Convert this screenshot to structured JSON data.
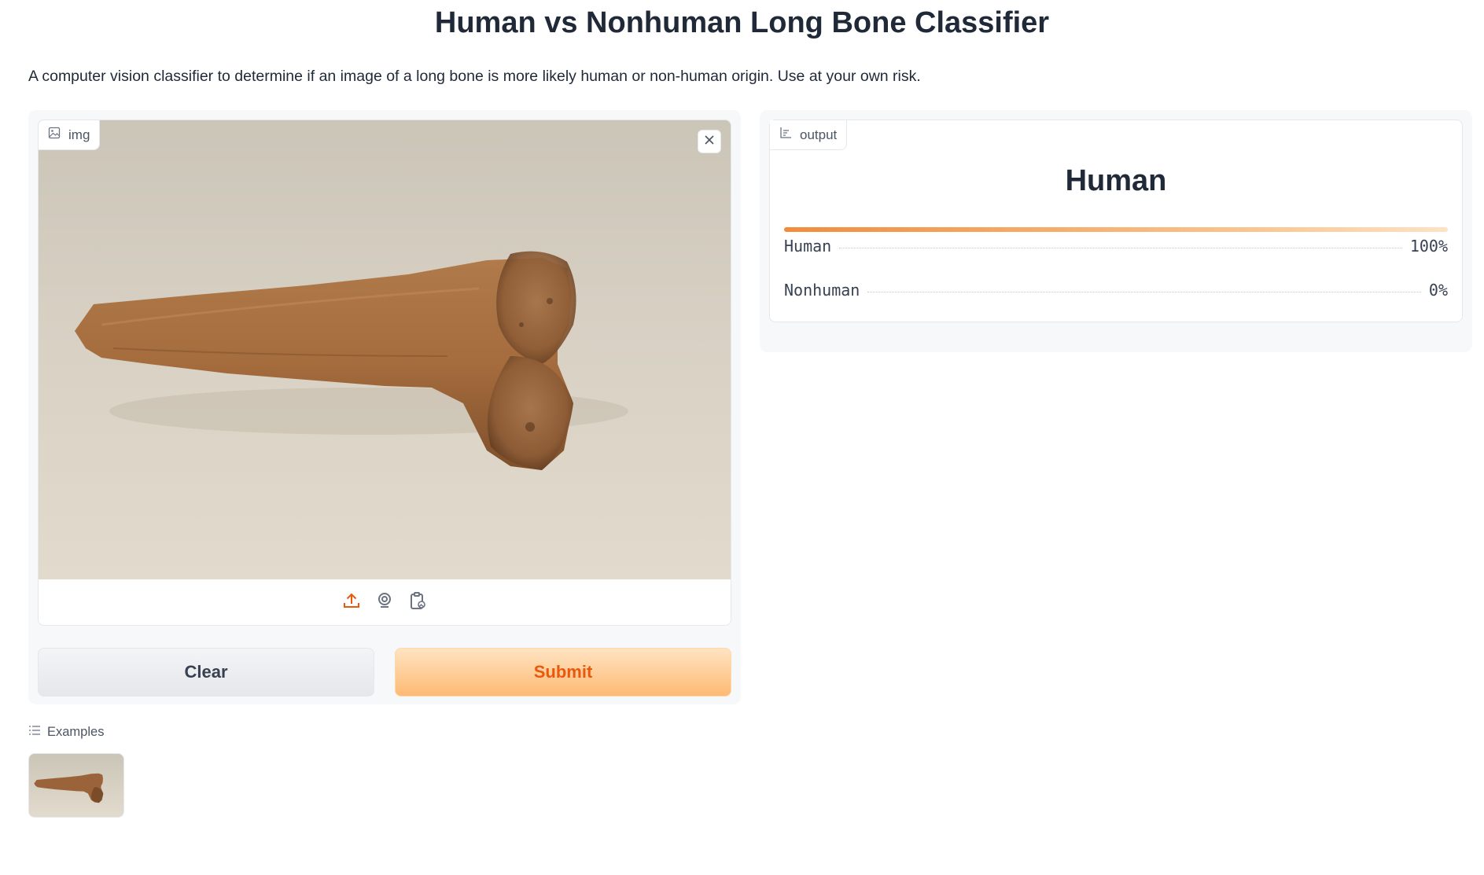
{
  "header": {
    "title": "Human vs Nonhuman Long Bone Classifier",
    "description": "A computer vision classifier to determine if an image of a long bone is more likely human or non-human origin. Use at your own risk."
  },
  "input": {
    "label": "img",
    "icons": [
      "image-icon",
      "close-icon",
      "upload-icon",
      "webcam-icon",
      "clipboard-icon"
    ],
    "clear_label": "Clear",
    "submit_label": "Submit"
  },
  "output": {
    "label": "output",
    "prediction": "Human",
    "confidences": [
      {
        "label": "Human",
        "value_text": "100%",
        "fraction": 1.0
      },
      {
        "label": "Nonhuman",
        "value_text": "0%",
        "fraction": 0.0
      }
    ]
  },
  "examples": {
    "label": "Examples"
  },
  "colors": {
    "accent": "#ea580c",
    "submit_bg": "#fdba74",
    "bar_start": "#f28c3b"
  }
}
